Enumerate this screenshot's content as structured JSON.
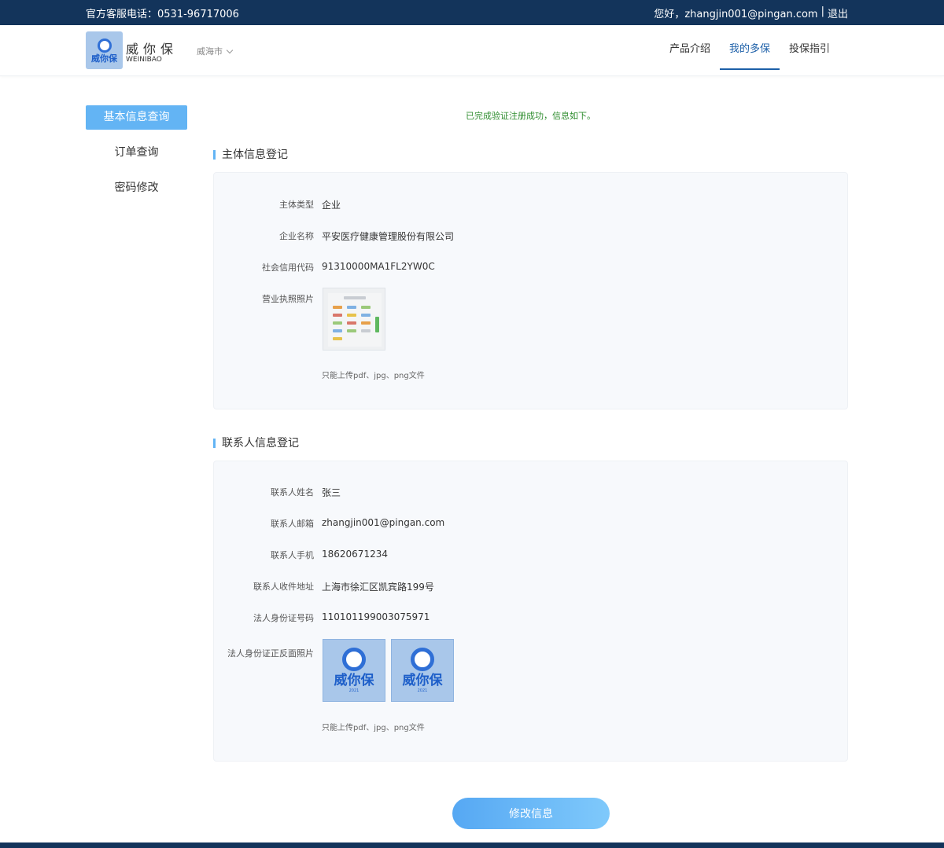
{
  "topbar": {
    "hotline": "官方客服电话：0531-96717006",
    "greeting": "您好，zhangjin001@pingan.com",
    "separator": "|",
    "logout": "退出"
  },
  "header": {
    "logo_text": "威你保",
    "brand_cn": "威你保",
    "brand_en": "WEINIBAO",
    "city": "威海市",
    "nav": [
      {
        "label": "产品介绍"
      },
      {
        "label": "我的多保"
      },
      {
        "label": "投保指引"
      }
    ]
  },
  "sidebar": {
    "items": [
      {
        "label": "基本信息查询",
        "active": true
      },
      {
        "label": "订单查询"
      },
      {
        "label": "密码修改"
      }
    ]
  },
  "notice": "已完成验证注册成功，信息如下。",
  "entity": {
    "title": "主体信息登记",
    "type_label": "主体类型",
    "type_value": "企业",
    "name_label": "企业名称",
    "name_value": "平安医疗健康管理股份有限公司",
    "credit_label": "社会信用代码",
    "credit_value": "91310000MA1FL2YW0C",
    "license_label": "营业执照照片",
    "hint": "只能上传pdf、jpg、png文件"
  },
  "contact": {
    "title": "联系人信息登记",
    "name_label": "联系人姓名",
    "name_value": "张三",
    "email_label": "联系人邮箱",
    "email_value": "zhangjin001@pingan.com",
    "phone_label": "联系人手机",
    "phone_value": "18620671234",
    "address_label": "联系人收件地址",
    "address_value": "上海市徐汇区凯宾路199号",
    "idno_label": "法人身份证号码",
    "idno_value": "110101199003075971",
    "idphoto_label": "法人身份证正反面照片",
    "id_logo_text": "威你保",
    "id_logo_small": "2021",
    "hint": "只能上传pdf、jpg、png文件"
  },
  "submit_label": "修改信息",
  "colors": {
    "topbar": "#13345b",
    "accent": "#63b4f4",
    "nav_active": "#1c5fa8",
    "success": "#2d8c2d"
  }
}
